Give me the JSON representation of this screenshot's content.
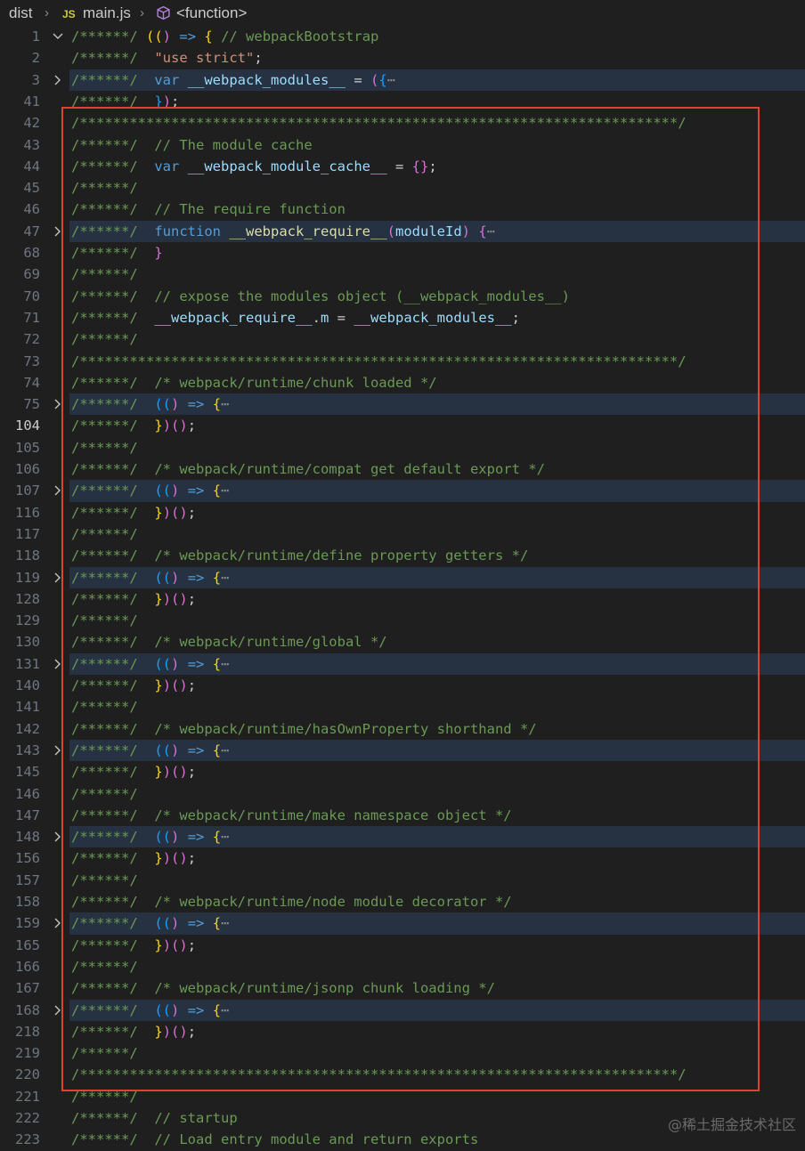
{
  "breadcrumb": {
    "folder": "dist",
    "file_badge": "JS",
    "file": "main.js",
    "symbol": "<function>"
  },
  "annotation": {
    "box_color": "#e0432f"
  },
  "watermark": "@稀土掘金技术社区",
  "lines": [
    {
      "n": "1",
      "fold": "open",
      "tokens": [
        [
          "com",
          "/******/ "
        ],
        [
          "p1",
          "(("
        ],
        [
          "p2",
          ")"
        ],
        [
          "op",
          " "
        ],
        [
          "kw",
          "=>"
        ],
        [
          "op",
          " "
        ],
        [
          "p1",
          "{"
        ],
        [
          "op",
          " "
        ],
        [
          "com",
          "// webpackBootstrap"
        ]
      ]
    },
    {
      "n": "2",
      "tokens": [
        [
          "com",
          "/******/ "
        ],
        [
          "op",
          "\t"
        ],
        [
          "str",
          "\"use strict\""
        ],
        [
          "op",
          ";"
        ]
      ]
    },
    {
      "n": "3",
      "fold": "closed",
      "hl": true,
      "tokens": [
        [
          "com",
          "/******/ "
        ],
        [
          "op",
          "\t"
        ],
        [
          "kw",
          "var"
        ],
        [
          "op",
          " "
        ],
        [
          "var",
          "__webpack_modules__"
        ],
        [
          "op",
          " = "
        ],
        [
          "p2",
          "("
        ],
        [
          "p3",
          "{"
        ],
        [
          "dots",
          "⋯"
        ]
      ]
    },
    {
      "n": "41",
      "tokens": [
        [
          "com",
          "/******/ "
        ],
        [
          "op",
          "\t"
        ],
        [
          "p3",
          "}"
        ],
        [
          "p2",
          ")"
        ],
        [
          "op",
          ";"
        ]
      ]
    },
    {
      "n": "42",
      "tokens": [
        [
          "com",
          "/************************************************************************/"
        ]
      ]
    },
    {
      "n": "43",
      "tokens": [
        [
          "com",
          "/******/ "
        ],
        [
          "op",
          "\t"
        ],
        [
          "com",
          "// The module cache"
        ]
      ]
    },
    {
      "n": "44",
      "tokens": [
        [
          "com",
          "/******/ "
        ],
        [
          "op",
          "\t"
        ],
        [
          "kw",
          "var"
        ],
        [
          "op",
          " "
        ],
        [
          "var",
          "__webpack_module_cache__"
        ],
        [
          "op",
          " = "
        ],
        [
          "p2",
          "{"
        ],
        [
          "p2",
          "}"
        ],
        [
          "op",
          ";"
        ]
      ]
    },
    {
      "n": "45",
      "tokens": [
        [
          "com",
          "/******/"
        ]
      ]
    },
    {
      "n": "46",
      "tokens": [
        [
          "com",
          "/******/ "
        ],
        [
          "op",
          "\t"
        ],
        [
          "com",
          "// The require function"
        ]
      ]
    },
    {
      "n": "47",
      "fold": "closed",
      "hl": true,
      "tokens": [
        [
          "com",
          "/******/ "
        ],
        [
          "op",
          "\t"
        ],
        [
          "kw",
          "function"
        ],
        [
          "op",
          " "
        ],
        [
          "fn",
          "__webpack_require__"
        ],
        [
          "p2",
          "("
        ],
        [
          "var",
          "moduleId"
        ],
        [
          "p2",
          ")"
        ],
        [
          "op",
          " "
        ],
        [
          "p2",
          "{"
        ],
        [
          "dots",
          "⋯"
        ]
      ]
    },
    {
      "n": "68",
      "tokens": [
        [
          "com",
          "/******/ "
        ],
        [
          "op",
          "\t"
        ],
        [
          "p2",
          "}"
        ]
      ]
    },
    {
      "n": "69",
      "tokens": [
        [
          "com",
          "/******/"
        ]
      ]
    },
    {
      "n": "70",
      "tokens": [
        [
          "com",
          "/******/ "
        ],
        [
          "op",
          "\t"
        ],
        [
          "com",
          "// expose the modules object (__webpack_modules__)"
        ]
      ]
    },
    {
      "n": "71",
      "tokens": [
        [
          "com",
          "/******/ "
        ],
        [
          "op",
          "\t"
        ],
        [
          "var",
          "__webpack_require__"
        ],
        [
          "op",
          "."
        ],
        [
          "var",
          "m"
        ],
        [
          "op",
          " = "
        ],
        [
          "var",
          "__webpack_modules__"
        ],
        [
          "op",
          ";"
        ]
      ]
    },
    {
      "n": "72",
      "tokens": [
        [
          "com",
          "/******/"
        ]
      ]
    },
    {
      "n": "73",
      "tokens": [
        [
          "com",
          "/************************************************************************/"
        ]
      ]
    },
    {
      "n": "74",
      "tokens": [
        [
          "com",
          "/******/ "
        ],
        [
          "op",
          "\t"
        ],
        [
          "com",
          "/* webpack/runtime/chunk loaded */"
        ]
      ]
    },
    {
      "n": "75",
      "fold": "closed",
      "hl": true,
      "tokens": [
        [
          "com",
          "/******/ "
        ],
        [
          "op",
          "\t"
        ],
        [
          "p3",
          "(("
        ],
        [
          "p2",
          ")"
        ],
        [
          "op",
          " "
        ],
        [
          "kw",
          "=>"
        ],
        [
          "op",
          " "
        ],
        [
          "p1",
          "{"
        ],
        [
          "dots",
          "⋯"
        ]
      ]
    },
    {
      "n": "104",
      "active": true,
      "tokens": [
        [
          "com",
          "/******/ "
        ],
        [
          "op",
          "\t"
        ],
        [
          "p1",
          "}"
        ],
        [
          "p2",
          ")"
        ],
        [
          "p2",
          "()"
        ],
        [
          "op",
          ";"
        ]
      ]
    },
    {
      "n": "105",
      "tokens": [
        [
          "com",
          "/******/"
        ]
      ]
    },
    {
      "n": "106",
      "tokens": [
        [
          "com",
          "/******/ "
        ],
        [
          "op",
          "\t"
        ],
        [
          "com",
          "/* webpack/runtime/compat get default export */"
        ]
      ]
    },
    {
      "n": "107",
      "fold": "closed",
      "hl": true,
      "tokens": [
        [
          "com",
          "/******/ "
        ],
        [
          "op",
          "\t"
        ],
        [
          "p3",
          "(("
        ],
        [
          "p2",
          ")"
        ],
        [
          "op",
          " "
        ],
        [
          "kw",
          "=>"
        ],
        [
          "op",
          " "
        ],
        [
          "p1",
          "{"
        ],
        [
          "dots",
          "⋯"
        ]
      ]
    },
    {
      "n": "116",
      "tokens": [
        [
          "com",
          "/******/ "
        ],
        [
          "op",
          "\t"
        ],
        [
          "p1",
          "}"
        ],
        [
          "p2",
          ")"
        ],
        [
          "p2",
          "()"
        ],
        [
          "op",
          ";"
        ]
      ]
    },
    {
      "n": "117",
      "tokens": [
        [
          "com",
          "/******/"
        ]
      ]
    },
    {
      "n": "118",
      "tokens": [
        [
          "com",
          "/******/ "
        ],
        [
          "op",
          "\t"
        ],
        [
          "com",
          "/* webpack/runtime/define property getters */"
        ]
      ]
    },
    {
      "n": "119",
      "fold": "closed",
      "hl": true,
      "tokens": [
        [
          "com",
          "/******/ "
        ],
        [
          "op",
          "\t"
        ],
        [
          "p3",
          "(("
        ],
        [
          "p2",
          ")"
        ],
        [
          "op",
          " "
        ],
        [
          "kw",
          "=>"
        ],
        [
          "op",
          " "
        ],
        [
          "p1",
          "{"
        ],
        [
          "dots",
          "⋯"
        ]
      ]
    },
    {
      "n": "128",
      "tokens": [
        [
          "com",
          "/******/ "
        ],
        [
          "op",
          "\t"
        ],
        [
          "p1",
          "}"
        ],
        [
          "p2",
          ")"
        ],
        [
          "p2",
          "()"
        ],
        [
          "op",
          ";"
        ]
      ]
    },
    {
      "n": "129",
      "tokens": [
        [
          "com",
          "/******/"
        ]
      ]
    },
    {
      "n": "130",
      "tokens": [
        [
          "com",
          "/******/ "
        ],
        [
          "op",
          "\t"
        ],
        [
          "com",
          "/* webpack/runtime/global */"
        ]
      ]
    },
    {
      "n": "131",
      "fold": "closed",
      "hl": true,
      "tokens": [
        [
          "com",
          "/******/ "
        ],
        [
          "op",
          "\t"
        ],
        [
          "p3",
          "(("
        ],
        [
          "p2",
          ")"
        ],
        [
          "op",
          " "
        ],
        [
          "kw",
          "=>"
        ],
        [
          "op",
          " "
        ],
        [
          "p1",
          "{"
        ],
        [
          "dots",
          "⋯"
        ]
      ]
    },
    {
      "n": "140",
      "tokens": [
        [
          "com",
          "/******/ "
        ],
        [
          "op",
          "\t"
        ],
        [
          "p1",
          "}"
        ],
        [
          "p2",
          ")"
        ],
        [
          "p2",
          "()"
        ],
        [
          "op",
          ";"
        ]
      ]
    },
    {
      "n": "141",
      "tokens": [
        [
          "com",
          "/******/"
        ]
      ]
    },
    {
      "n": "142",
      "tokens": [
        [
          "com",
          "/******/ "
        ],
        [
          "op",
          "\t"
        ],
        [
          "com",
          "/* webpack/runtime/hasOwnProperty shorthand */"
        ]
      ]
    },
    {
      "n": "143",
      "fold": "closed",
      "hl": true,
      "tokens": [
        [
          "com",
          "/******/ "
        ],
        [
          "op",
          "\t"
        ],
        [
          "p3",
          "(("
        ],
        [
          "p2",
          ")"
        ],
        [
          "op",
          " "
        ],
        [
          "kw",
          "=>"
        ],
        [
          "op",
          " "
        ],
        [
          "p1",
          "{"
        ],
        [
          "dots",
          "⋯"
        ]
      ]
    },
    {
      "n": "145",
      "tokens": [
        [
          "com",
          "/******/ "
        ],
        [
          "op",
          "\t"
        ],
        [
          "p1",
          "}"
        ],
        [
          "p2",
          ")"
        ],
        [
          "p2",
          "()"
        ],
        [
          "op",
          ";"
        ]
      ]
    },
    {
      "n": "146",
      "tokens": [
        [
          "com",
          "/******/"
        ]
      ]
    },
    {
      "n": "147",
      "tokens": [
        [
          "com",
          "/******/ "
        ],
        [
          "op",
          "\t"
        ],
        [
          "com",
          "/* webpack/runtime/make namespace object */"
        ]
      ]
    },
    {
      "n": "148",
      "fold": "closed",
      "hl": true,
      "tokens": [
        [
          "com",
          "/******/ "
        ],
        [
          "op",
          "\t"
        ],
        [
          "p3",
          "(("
        ],
        [
          "p2",
          ")"
        ],
        [
          "op",
          " "
        ],
        [
          "kw",
          "=>"
        ],
        [
          "op",
          " "
        ],
        [
          "p1",
          "{"
        ],
        [
          "dots",
          "⋯"
        ]
      ]
    },
    {
      "n": "156",
      "tokens": [
        [
          "com",
          "/******/ "
        ],
        [
          "op",
          "\t"
        ],
        [
          "p1",
          "}"
        ],
        [
          "p2",
          ")"
        ],
        [
          "p2",
          "()"
        ],
        [
          "op",
          ";"
        ]
      ]
    },
    {
      "n": "157",
      "tokens": [
        [
          "com",
          "/******/"
        ]
      ]
    },
    {
      "n": "158",
      "tokens": [
        [
          "com",
          "/******/ "
        ],
        [
          "op",
          "\t"
        ],
        [
          "com",
          "/* webpack/runtime/node module decorator */"
        ]
      ]
    },
    {
      "n": "159",
      "fold": "closed",
      "hl": true,
      "tokens": [
        [
          "com",
          "/******/ "
        ],
        [
          "op",
          "\t"
        ],
        [
          "p3",
          "(("
        ],
        [
          "p2",
          ")"
        ],
        [
          "op",
          " "
        ],
        [
          "kw",
          "=>"
        ],
        [
          "op",
          " "
        ],
        [
          "p1",
          "{"
        ],
        [
          "dots",
          "⋯"
        ]
      ]
    },
    {
      "n": "165",
      "tokens": [
        [
          "com",
          "/******/ "
        ],
        [
          "op",
          "\t"
        ],
        [
          "p1",
          "}"
        ],
        [
          "p2",
          ")"
        ],
        [
          "p2",
          "()"
        ],
        [
          "op",
          ";"
        ]
      ]
    },
    {
      "n": "166",
      "tokens": [
        [
          "com",
          "/******/"
        ]
      ]
    },
    {
      "n": "167",
      "tokens": [
        [
          "com",
          "/******/ "
        ],
        [
          "op",
          "\t"
        ],
        [
          "com",
          "/* webpack/runtime/jsonp chunk loading */"
        ]
      ]
    },
    {
      "n": "168",
      "fold": "closed",
      "hl": true,
      "tokens": [
        [
          "com",
          "/******/ "
        ],
        [
          "op",
          "\t"
        ],
        [
          "p3",
          "(("
        ],
        [
          "p2",
          ")"
        ],
        [
          "op",
          " "
        ],
        [
          "kw",
          "=>"
        ],
        [
          "op",
          " "
        ],
        [
          "p1",
          "{"
        ],
        [
          "dots",
          "⋯"
        ]
      ]
    },
    {
      "n": "218",
      "tokens": [
        [
          "com",
          "/******/ "
        ],
        [
          "op",
          "\t"
        ],
        [
          "p1",
          "}"
        ],
        [
          "p2",
          ")"
        ],
        [
          "p2",
          "()"
        ],
        [
          "op",
          ";"
        ]
      ]
    },
    {
      "n": "219",
      "tokens": [
        [
          "com",
          "/******/"
        ]
      ]
    },
    {
      "n": "220",
      "tokens": [
        [
          "com",
          "/************************************************************************/"
        ]
      ]
    },
    {
      "n": "221",
      "tokens": [
        [
          "com",
          "/******/"
        ]
      ]
    },
    {
      "n": "222",
      "tokens": [
        [
          "com",
          "/******/ "
        ],
        [
          "op",
          "\t"
        ],
        [
          "com",
          "// startup"
        ]
      ]
    },
    {
      "n": "223",
      "tokens": [
        [
          "com",
          "/******/ "
        ],
        [
          "op",
          "\t"
        ],
        [
          "com",
          "// Load entry module and return exports"
        ]
      ]
    }
  ]
}
